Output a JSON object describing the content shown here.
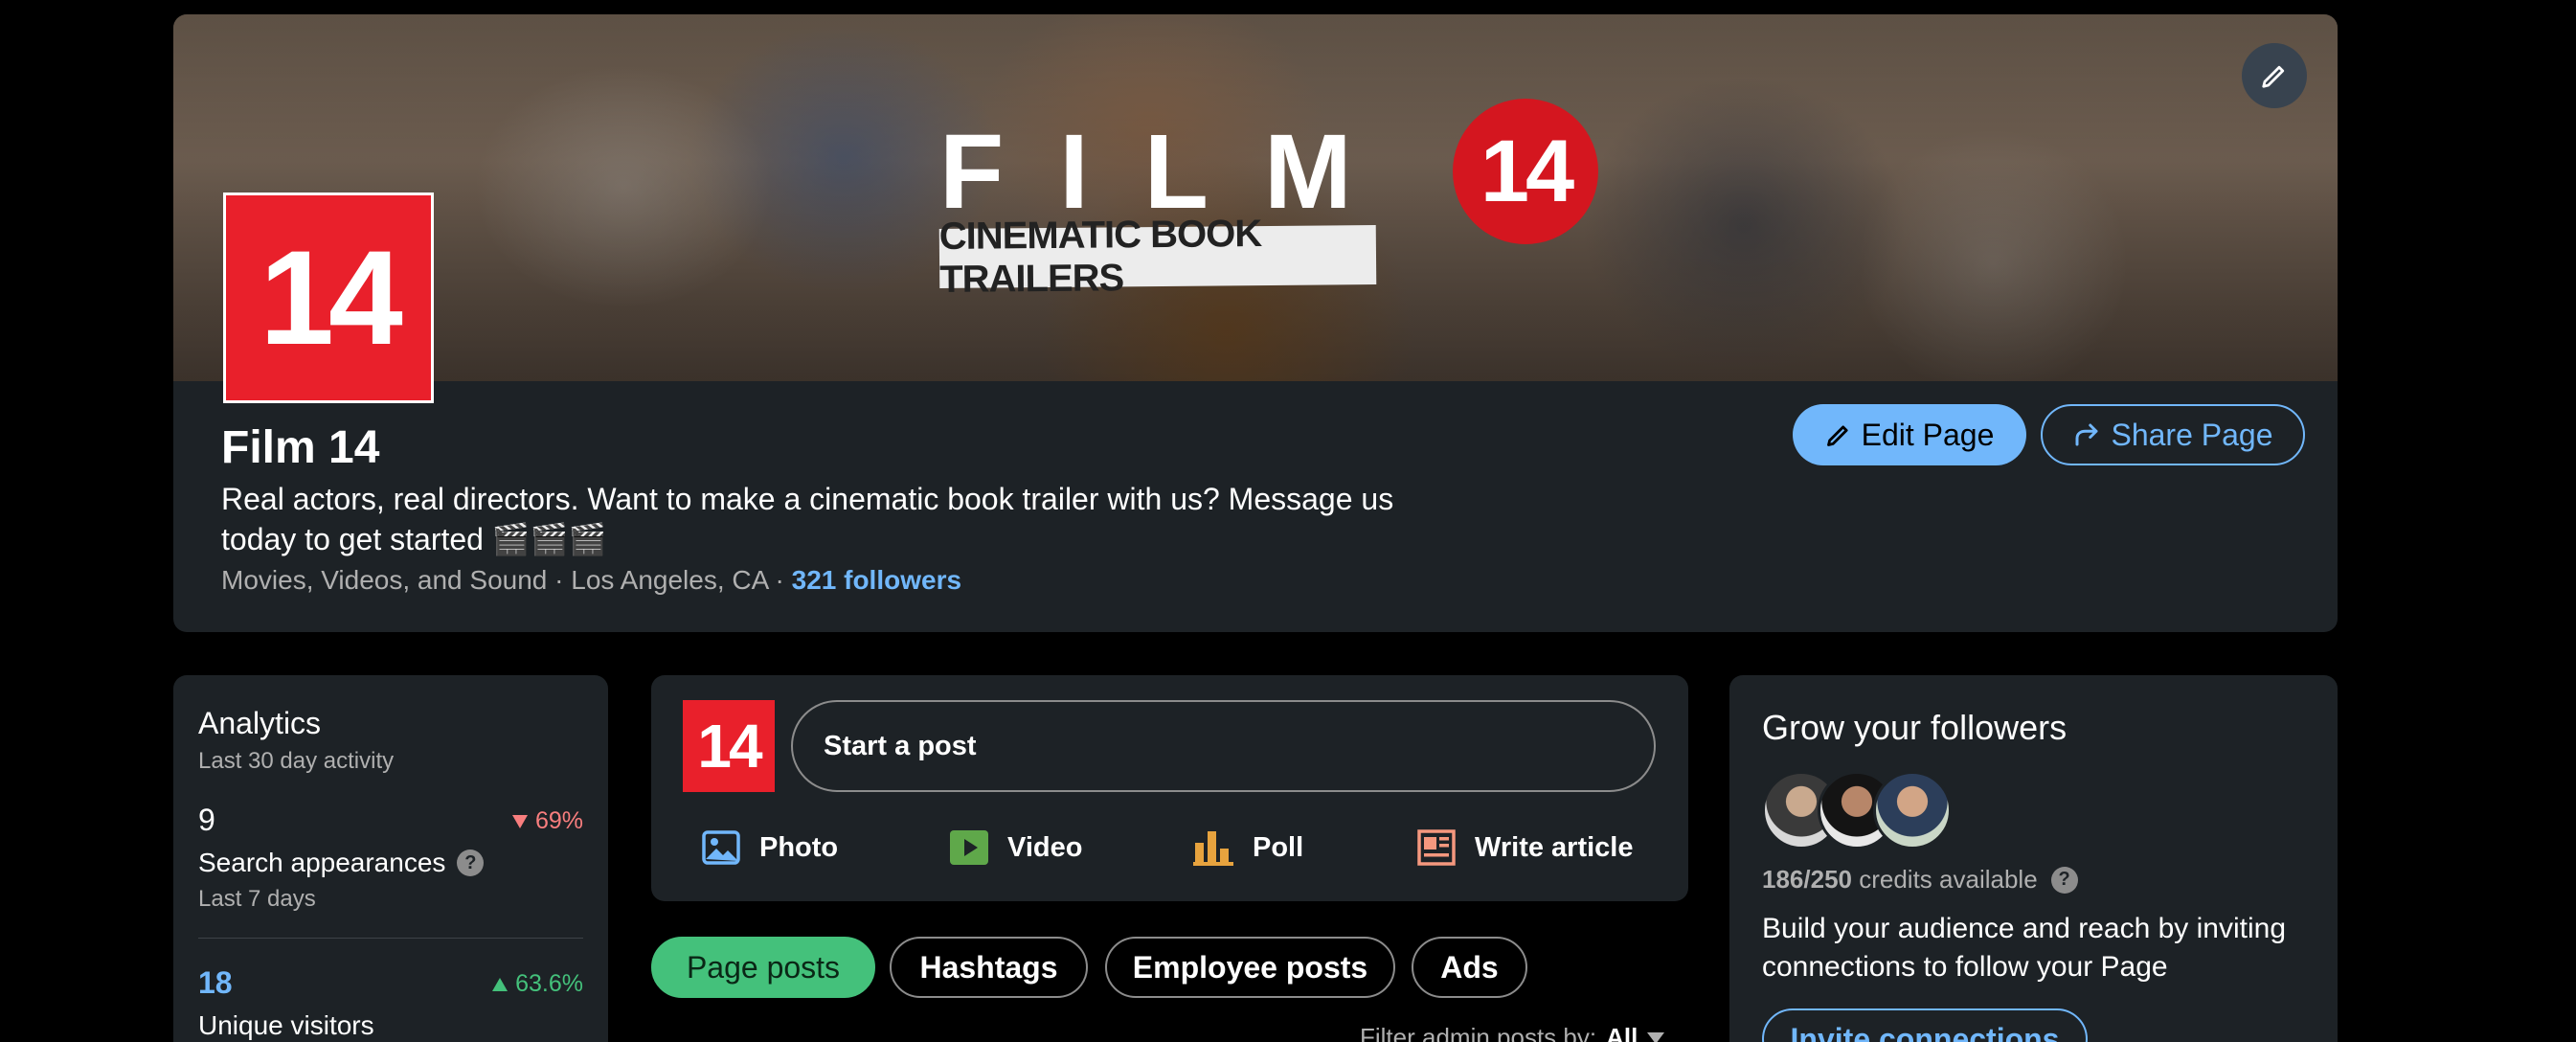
{
  "banner": {
    "title": "FILM",
    "badge": "14",
    "strip_text": "CINEMATIC BOOK TRAILERS"
  },
  "page": {
    "logo_text": "14",
    "name": "Film 14",
    "tagline": "Real actors, real directors. Want to make a cinematic book trailer with us? Message us today to get started 🎬🎬🎬",
    "meta_prefix": "Movies, Videos, and Sound · Los Angeles, CA · ",
    "followers": "321 followers",
    "edit_label": "Edit Page",
    "share_label": "Share Page"
  },
  "analytics": {
    "title": "Analytics",
    "subtitle": "Last 30 day activity",
    "metrics": [
      {
        "value": "9",
        "change": "69%",
        "direction": "down",
        "label": "Search appearances",
        "period": "Last 7 days"
      },
      {
        "value": "18",
        "change": "63.6%",
        "direction": "up",
        "label": "Unique visitors",
        "period": ""
      }
    ]
  },
  "composer": {
    "logo_text": "14",
    "placeholder": "Start a post",
    "actions": [
      {
        "label": "Photo",
        "icon": "photo-icon"
      },
      {
        "label": "Video",
        "icon": "video-icon"
      },
      {
        "label": "Poll",
        "icon": "poll-icon"
      },
      {
        "label": "Write article",
        "icon": "article-icon"
      }
    ]
  },
  "filters": {
    "pills": [
      "Page posts",
      "Hashtags",
      "Employee posts",
      "Ads"
    ],
    "active": "Page posts",
    "admin_label": "Filter admin posts by:",
    "admin_value": "All"
  },
  "grow": {
    "title": "Grow your followers",
    "credits_used": "186/250",
    "credits_suffix": "credits available",
    "description": "Build your audience and reach by inviting connections to follow your Page",
    "invite_label": "Invite connections"
  },
  "colors": {
    "accent": "#71b7fb",
    "card": "#1d2226",
    "success": "#44c17b",
    "danger": "#f87e7e",
    "brand_red": "#e9202b"
  }
}
